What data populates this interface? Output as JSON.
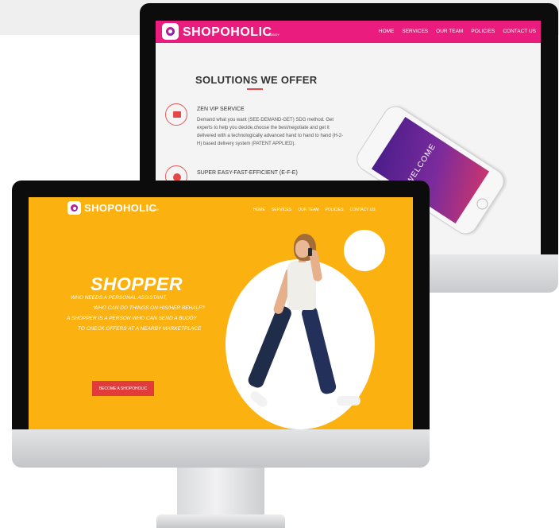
{
  "back_site": {
    "logo": {
      "text": "SHOPOHOLIC",
      "sub": "BUDDY"
    },
    "nav": [
      "HOME",
      "SERVICES",
      "OUR TEAM",
      "POLICIES",
      "CONTACT US"
    ],
    "section_title": "SOLUTIONS WE OFFER",
    "services": [
      {
        "icon": "monitor-icon",
        "title": "ZEN VIP SERVICE",
        "description": "Demand what you want (SEE-DEMAND-GET) SDG method. Get experts to help you decide,choose the best/negotiate and get it delivered with a technologically advanced hand to hand to hand (H-2-H) based delivery system (PATENT APPLIED)."
      },
      {
        "icon": "parking-icon",
        "title": "SUPER EASY-FAST-EFFICIENT (E-F-E)"
      }
    ],
    "phone_screen_text": "WELCOME"
  },
  "front_site": {
    "logo": {
      "text": "SHOPOHOLIC",
      "sub": "BUDDY"
    },
    "nav": [
      "HOME",
      "SERVICES",
      "OUR TEAM",
      "POLICIES",
      "CONTACT US"
    ],
    "hero": {
      "title": "SHOPPER",
      "lines": [
        "WHO NEEDS A PERSONAL ASSISTANT,",
        "WHO CAN DO THINGS ON HIS/HER BEHALF?",
        "A SHOPPER IS A PERSON WHO CAN SEND A BUDDY",
        "TO CHECK OFFERS AT A NEARBY MARKETPLACE"
      ],
      "cta": "BECOME A SHOPOHOLIC"
    }
  },
  "colors": {
    "back_nav": "#ea1c7d",
    "front_bg": "#fbb10f",
    "cta": "#e23b3b",
    "accent_red": "#e34848"
  }
}
